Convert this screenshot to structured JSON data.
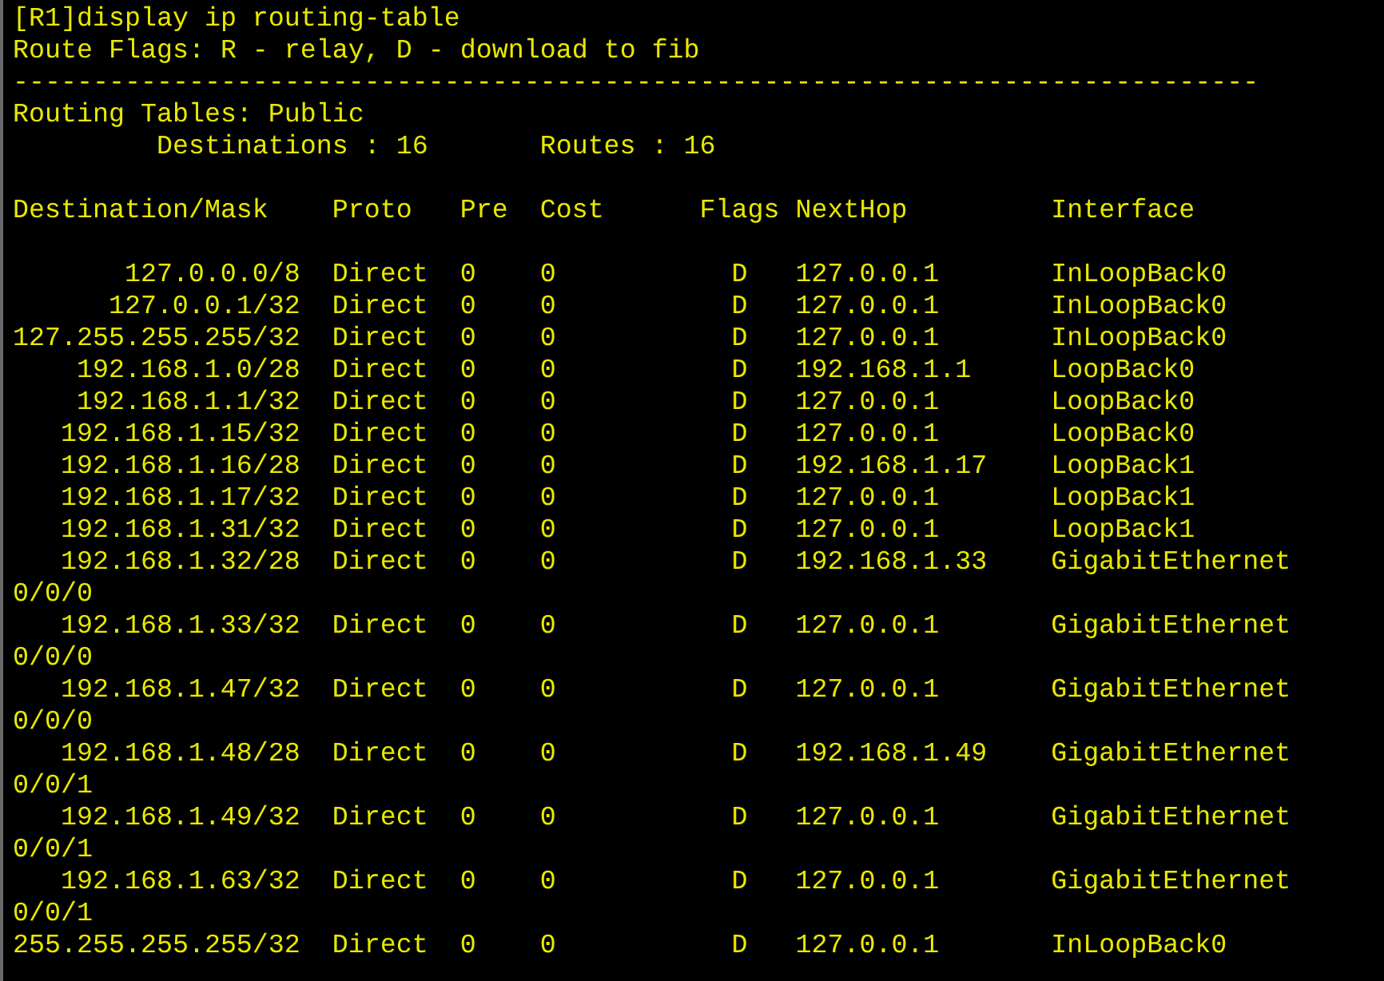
{
  "command": "[R1]display ip routing-table",
  "flags_legend": "Route Flags: R - relay, D - download to fib",
  "separator": "------------------------------------------------------------------------------",
  "table_title": "Routing Tables: Public",
  "summary": {
    "destinations": "Destinations : 16",
    "routes": "Routes : 16"
  },
  "columns": [
    "Destination/Mask",
    "Proto",
    "Pre",
    "Cost",
    "Flags",
    "NextHop",
    "Interface"
  ],
  "rows": [
    {
      "destination": "127.0.0.0/8",
      "proto": "Direct",
      "pre": "0",
      "cost": "0",
      "flags": "D",
      "nexthop": "127.0.0.1",
      "interface": "InLoopBack0"
    },
    {
      "destination": "127.0.0.1/32",
      "proto": "Direct",
      "pre": "0",
      "cost": "0",
      "flags": "D",
      "nexthop": "127.0.0.1",
      "interface": "InLoopBack0"
    },
    {
      "destination": "127.255.255.255/32",
      "proto": "Direct",
      "pre": "0",
      "cost": "0",
      "flags": "D",
      "nexthop": "127.0.0.1",
      "interface": "InLoopBack0"
    },
    {
      "destination": "192.168.1.0/28",
      "proto": "Direct",
      "pre": "0",
      "cost": "0",
      "flags": "D",
      "nexthop": "192.168.1.1",
      "interface": "LoopBack0"
    },
    {
      "destination": "192.168.1.1/32",
      "proto": "Direct",
      "pre": "0",
      "cost": "0",
      "flags": "D",
      "nexthop": "127.0.0.1",
      "interface": "LoopBack0"
    },
    {
      "destination": "192.168.1.15/32",
      "proto": "Direct",
      "pre": "0",
      "cost": "0",
      "flags": "D",
      "nexthop": "127.0.0.1",
      "interface": "LoopBack0"
    },
    {
      "destination": "192.168.1.16/28",
      "proto": "Direct",
      "pre": "0",
      "cost": "0",
      "flags": "D",
      "nexthop": "192.168.1.17",
      "interface": "LoopBack1"
    },
    {
      "destination": "192.168.1.17/32",
      "proto": "Direct",
      "pre": "0",
      "cost": "0",
      "flags": "D",
      "nexthop": "127.0.0.1",
      "interface": "LoopBack1"
    },
    {
      "destination": "192.168.1.31/32",
      "proto": "Direct",
      "pre": "0",
      "cost": "0",
      "flags": "D",
      "nexthop": "127.0.0.1",
      "interface": "LoopBack1"
    },
    {
      "destination": "192.168.1.32/28",
      "proto": "Direct",
      "pre": "0",
      "cost": "0",
      "flags": "D",
      "nexthop": "192.168.1.33",
      "interface": "GigabitEthernet",
      "interface_wrap": "0/0/0"
    },
    {
      "destination": "192.168.1.33/32",
      "proto": "Direct",
      "pre": "0",
      "cost": "0",
      "flags": "D",
      "nexthop": "127.0.0.1",
      "interface": "GigabitEthernet",
      "interface_wrap": "0/0/0"
    },
    {
      "destination": "192.168.1.47/32",
      "proto": "Direct",
      "pre": "0",
      "cost": "0",
      "flags": "D",
      "nexthop": "127.0.0.1",
      "interface": "GigabitEthernet",
      "interface_wrap": "0/0/0"
    },
    {
      "destination": "192.168.1.48/28",
      "proto": "Direct",
      "pre": "0",
      "cost": "0",
      "flags": "D",
      "nexthop": "192.168.1.49",
      "interface": "GigabitEthernet",
      "interface_wrap": "0/0/1"
    },
    {
      "destination": "192.168.1.49/32",
      "proto": "Direct",
      "pre": "0",
      "cost": "0",
      "flags": "D",
      "nexthop": "127.0.0.1",
      "interface": "GigabitEthernet",
      "interface_wrap": "0/0/1"
    },
    {
      "destination": "192.168.1.63/32",
      "proto": "Direct",
      "pre": "0",
      "cost": "0",
      "flags": "D",
      "nexthop": "127.0.0.1",
      "interface": "GigabitEthernet",
      "interface_wrap": "0/0/1"
    },
    {
      "destination": "255.255.255.255/32",
      "proto": "Direct",
      "pre": "0",
      "cost": "0",
      "flags": "D",
      "nexthop": "127.0.0.1",
      "interface": "InLoopBack0"
    }
  ]
}
